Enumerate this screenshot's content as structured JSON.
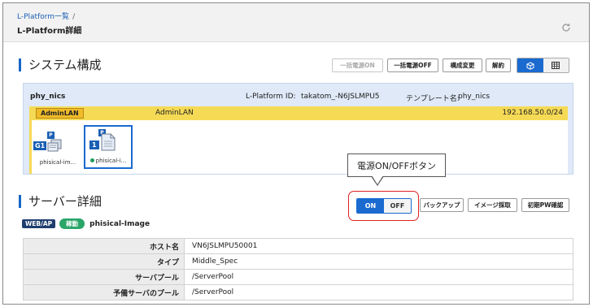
{
  "header": {
    "breadcrumb": "L-Platform一覧",
    "breadcrumb_sep": "/",
    "title": "L-Platform詳細",
    "refresh_icon": "refresh-icon"
  },
  "system": {
    "title": "システム構成",
    "buttons": {
      "bulk_power_on": "一括電源ON",
      "bulk_power_off": "一括電源OFF",
      "change_config": "構成変更",
      "cancel": "解約"
    },
    "view_toggle": {
      "diagram_icon": "cube-icon",
      "table_icon": "grid-icon"
    },
    "lplatform_name": "phy_nics",
    "lplatform_id_label": "L-Platform ID:",
    "lplatform_id": "takatom_-N6JSLMPU5",
    "template_label": "テンプレート名:",
    "template": "phy_nics",
    "network": {
      "badge": "AdminLAN",
      "name": "AdminLAN",
      "address": "192.168.50.0/24"
    },
    "nodes": [
      {
        "label": "phisical-im...",
        "badge": "G1",
        "p_badge": "P",
        "icon": "server-group-icon"
      },
      {
        "label": "phisical-i...",
        "badge": "1",
        "p_badge": "P",
        "icon": "server-icon",
        "status": "running",
        "selected": true
      }
    ]
  },
  "callout": {
    "text": "電源ON/OFFボタン"
  },
  "server": {
    "title": "サーバー詳細",
    "power": {
      "on": "ON",
      "off": "OFF",
      "state": "on"
    },
    "buttons": {
      "backup": "バックアップ",
      "image_capture": "イメージ採取",
      "initial_pw": "初期PW確認"
    },
    "tags": {
      "role": "WEB/AP",
      "status": "稼動",
      "image": "phisical-Image"
    },
    "details": [
      {
        "key": "ホスト名",
        "value": "VN6JSLMPU50001"
      },
      {
        "key": "タイプ",
        "value": "Middle_Spec"
      },
      {
        "key": "サーバプール",
        "value": "/ServerPool"
      },
      {
        "key": "予備サーバのプール",
        "value": "/ServerPool"
      }
    ]
  },
  "colors": {
    "accent": "#1a6ad0",
    "lan_bar": "#f5da55",
    "panel_bg": "#dfe9f7",
    "running": "#2aa669",
    "callout_highlight": "#e12020"
  }
}
